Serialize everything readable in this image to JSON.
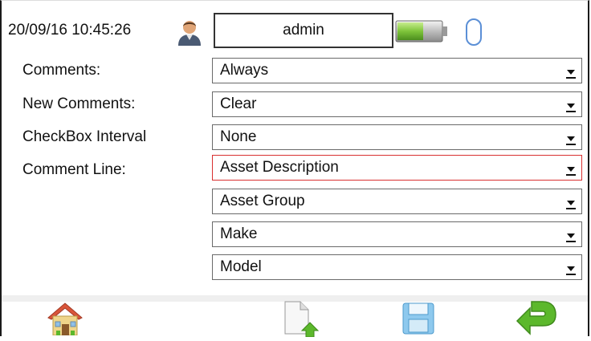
{
  "status_bar": {
    "datetime": "20/09/16 10:45:26",
    "user_icon": "user-icon",
    "username": "admin",
    "battery_icon": "battery-icon",
    "battery_level": 0.6,
    "connection_icon": "connection-icon"
  },
  "form": {
    "comments": {
      "label": "Comments:",
      "value": "Always"
    },
    "new_comments": {
      "label": "New Comments:",
      "value": "Clear"
    },
    "checkbox_interval": {
      "label": "CheckBox Interval",
      "value": "None"
    },
    "comment_line": {
      "label": "Comment Line:",
      "values": [
        "Asset Description",
        "Asset Group",
        "Make",
        "Model"
      ]
    }
  },
  "toolbar": {
    "home_icon": "home-icon",
    "export_icon": "export-document-icon",
    "save_icon": "save-icon",
    "back_icon": "back-icon"
  },
  "colors": {
    "focus_border": "#d93030",
    "battery_green": "#7ec43a",
    "back_arrow_green": "#5cb82c",
    "home_roof": "#d9553a"
  }
}
